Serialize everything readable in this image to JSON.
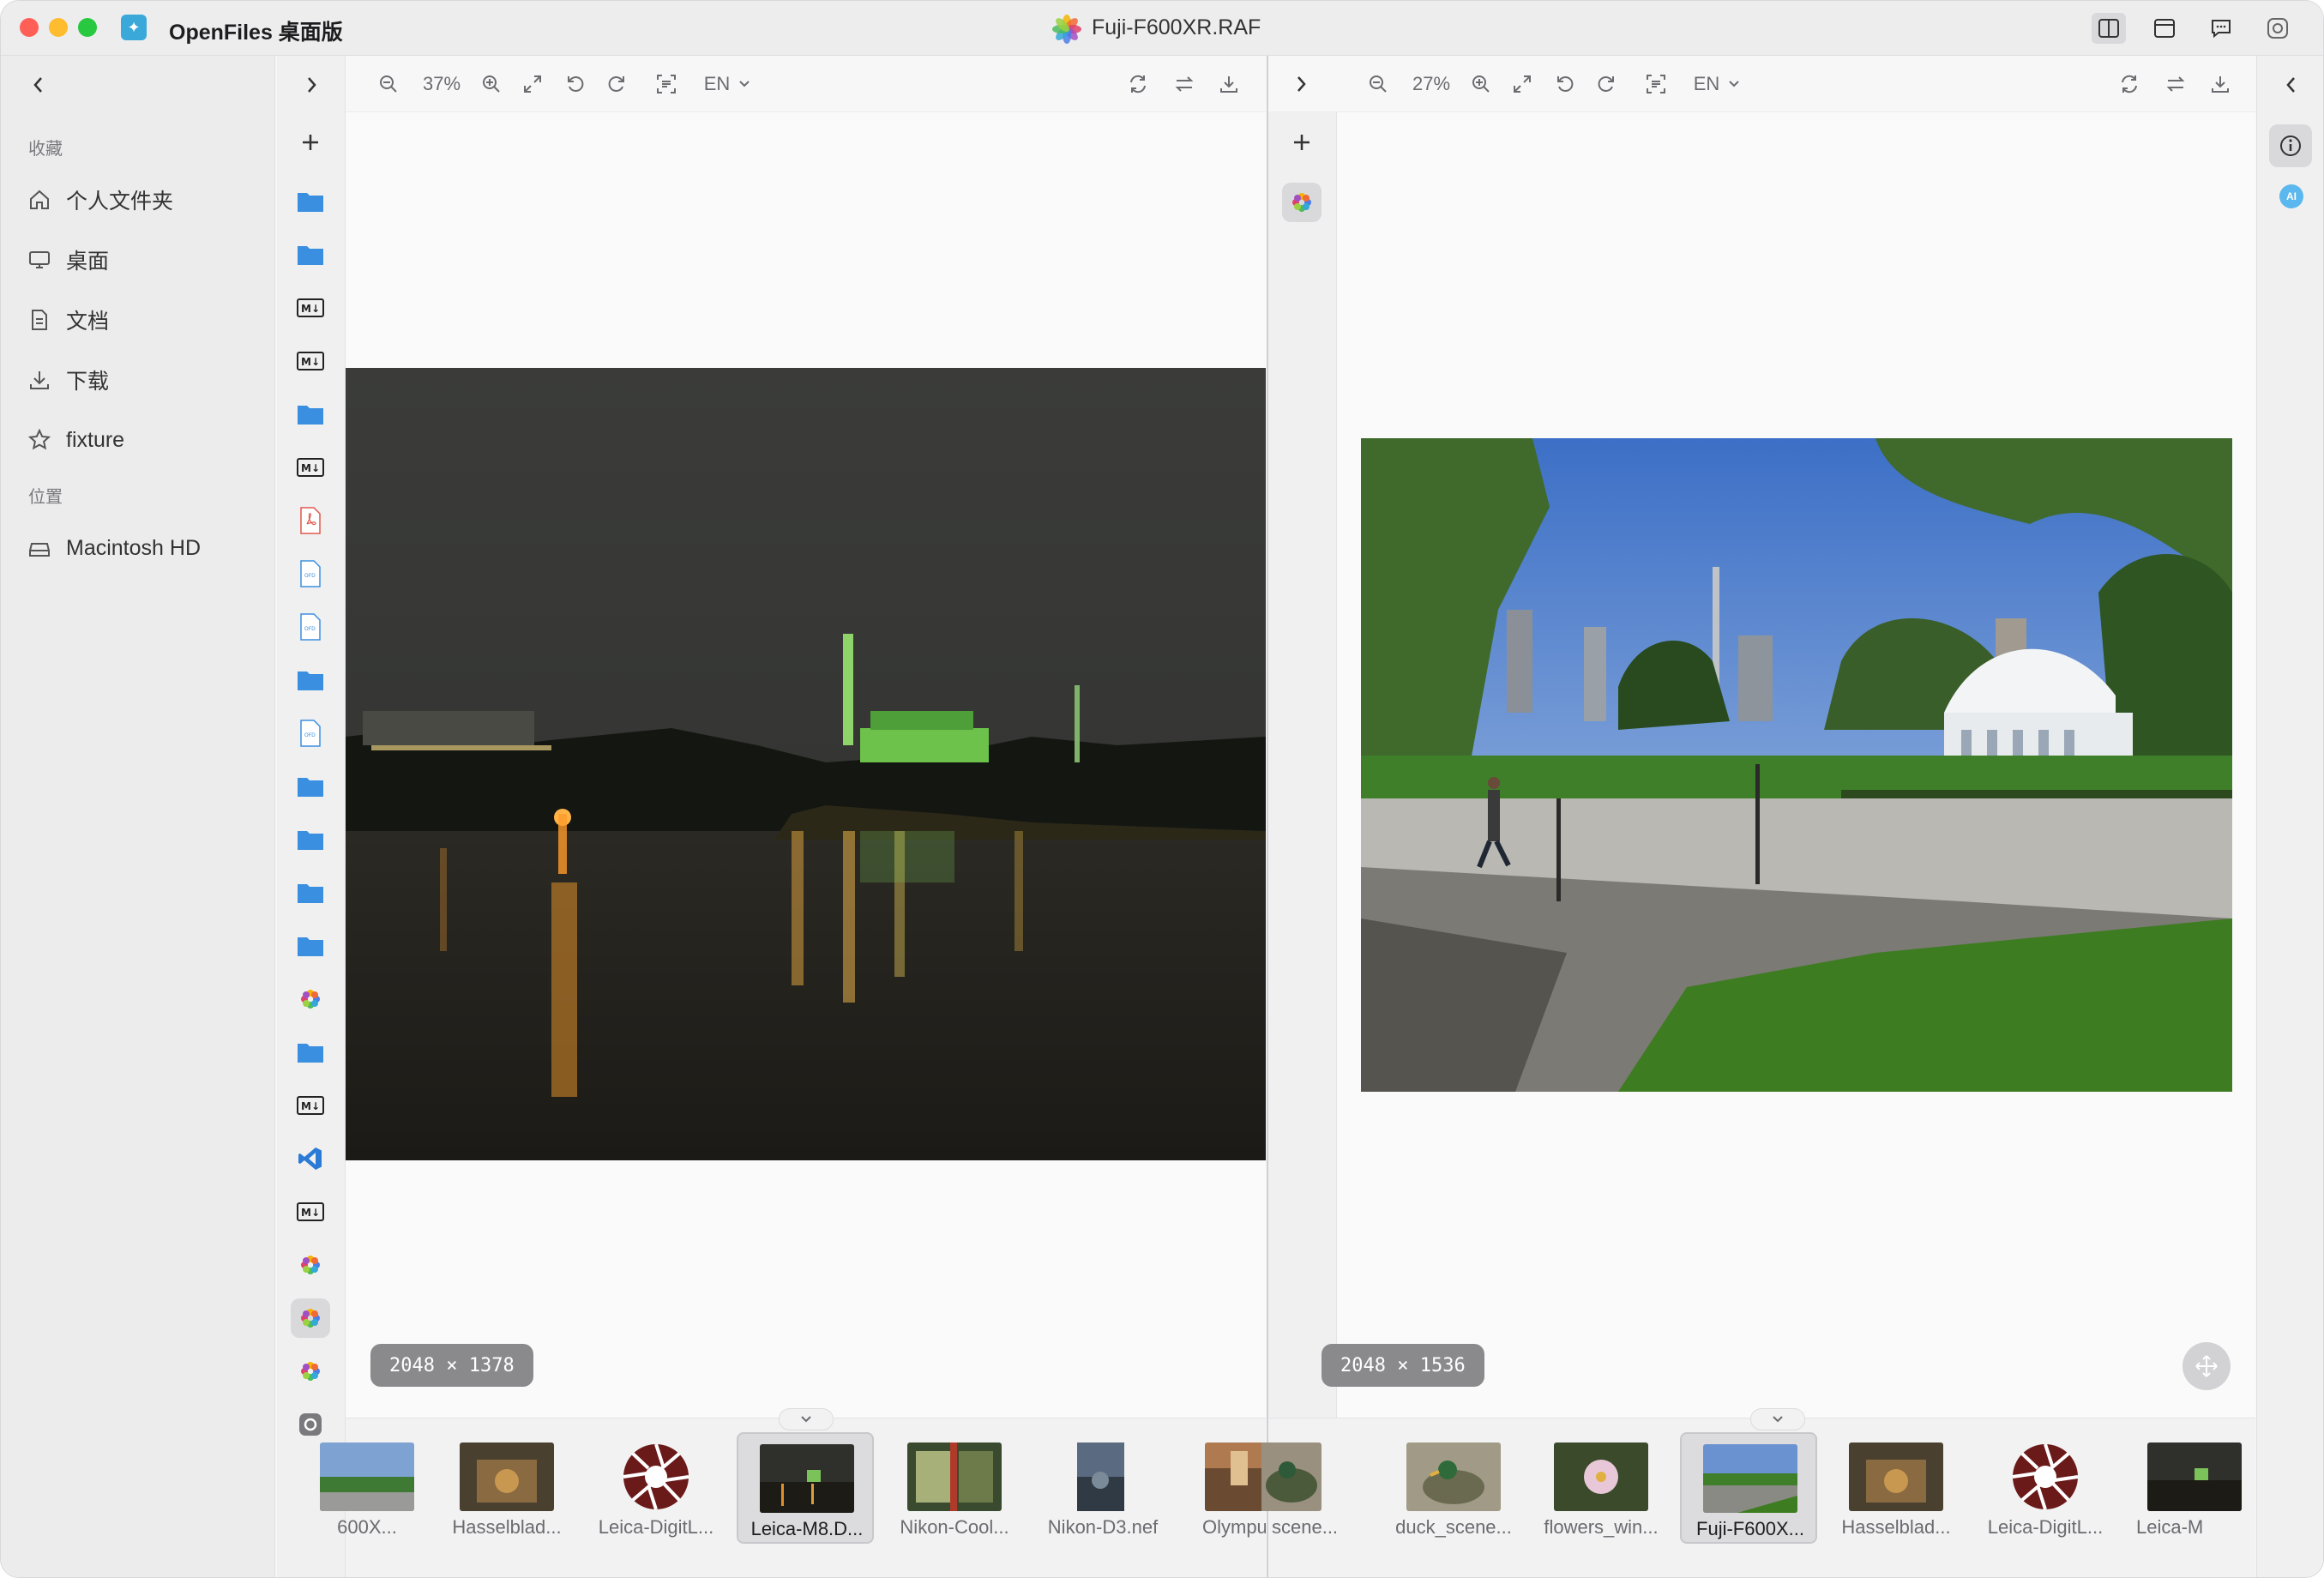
{
  "app": {
    "title": "OpenFiles 桌面版",
    "document_title": "Fuji-F600XR.RAF"
  },
  "sidebar": {
    "favorites_heading": "收藏",
    "items": [
      {
        "label": "个人文件夹",
        "icon": "home-icon"
      },
      {
        "label": "桌面",
        "icon": "desktop-icon"
      },
      {
        "label": "文档",
        "icon": "document-icon"
      },
      {
        "label": "下载",
        "icon": "download-icon"
      },
      {
        "label": "fixture",
        "icon": "star-icon"
      }
    ],
    "locations_heading": "位置",
    "locations": [
      {
        "label": "Macintosh HD",
        "icon": "drive-icon"
      }
    ]
  },
  "left_pane": {
    "zoom": "37%",
    "language": "EN",
    "dimensions": "2048 × 1378",
    "thumbnails": [
      {
        "label": "600X..."
      },
      {
        "label": "Hasselblad..."
      },
      {
        "label": "Leica-DigitL..."
      },
      {
        "label": "Leica-M8.D...",
        "selected": true
      },
      {
        "label": "Nikon-Cool..."
      },
      {
        "label": "Nikon-D3.nef"
      },
      {
        "label": "Olympu"
      }
    ]
  },
  "right_pane": {
    "zoom": "27%",
    "language": "EN",
    "dimensions": "2048 × 1536",
    "thumbnails": [
      {
        "label": "scene..."
      },
      {
        "label": "duck_scene..."
      },
      {
        "label": "flowers_win..."
      },
      {
        "label": "Fuji-F600X...",
        "selected": true
      },
      {
        "label": "Hasselblad..."
      },
      {
        "label": "Leica-DigitL..."
      },
      {
        "label": "Leica-M"
      }
    ]
  },
  "rail": {
    "ai_label": "AI"
  },
  "colors": {
    "accent": "#3b8fe0",
    "folder": "#3b8fe0",
    "selection": "#d9d9dc"
  }
}
